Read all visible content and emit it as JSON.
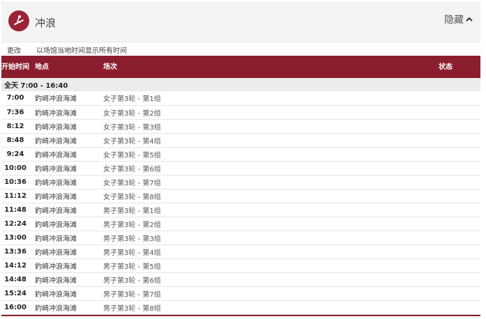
{
  "header": {
    "sport_title": "冲浪",
    "hide_label": "隐藏",
    "icon": "surfing-icon",
    "accent_color": "#8b1e2e"
  },
  "subbar": {
    "change_label": "更改",
    "timezone_note": "以场馆当地时间显示所有时间"
  },
  "table": {
    "headers": {
      "start_time": "开始时间",
      "venue": "地点",
      "event": "场次",
      "status": "状态"
    },
    "allday_label": "全天  7:00 - 16:40",
    "rows": [
      {
        "time": "7:00",
        "venue": "釣崎冲浪海滩",
        "event": "女子第3轮 - 第1组"
      },
      {
        "time": "7:36",
        "venue": "釣崎冲浪海滩",
        "event": "女子第3轮 - 第2组"
      },
      {
        "time": "8:12",
        "venue": "釣崎冲浪海滩",
        "event": "女子第3轮 - 第3组"
      },
      {
        "time": "8:48",
        "venue": "釣崎冲浪海滩",
        "event": "女子第3轮 - 第4组"
      },
      {
        "time": "9:24",
        "venue": "釣崎冲浪海滩",
        "event": "女子第3轮 - 第5组"
      },
      {
        "time": "10:00",
        "venue": "釣崎冲浪海滩",
        "event": "女子第3轮 - 第6组"
      },
      {
        "time": "10:36",
        "venue": "釣崎冲浪海滩",
        "event": "女子第3轮 - 第7组"
      },
      {
        "time": "11:12",
        "venue": "釣崎冲浪海滩",
        "event": "女子第3轮 - 第8组"
      },
      {
        "time": "11:48",
        "venue": "釣崎冲浪海滩",
        "event": "男子第3轮 - 第1组"
      },
      {
        "time": "12:24",
        "venue": "釣崎冲浪海滩",
        "event": "男子第3轮 - 第2组"
      },
      {
        "time": "13:00",
        "venue": "釣崎冲浪海滩",
        "event": "男子第3轮 - 第3组"
      },
      {
        "time": "13:36",
        "venue": "釣崎冲浪海滩",
        "event": "男子第3轮 - 第4组"
      },
      {
        "time": "14:12",
        "venue": "釣崎冲浪海滩",
        "event": "男子第3轮 - 第5组"
      },
      {
        "time": "14:48",
        "venue": "釣崎冲浪海滩",
        "event": "男子第3轮 - 第6组"
      },
      {
        "time": "15:24",
        "venue": "釣崎冲浪海滩",
        "event": "男子第3轮 - 第7组"
      },
      {
        "time": "16:00",
        "venue": "釣崎冲浪海滩",
        "event": "男子第3轮 - 第8组"
      }
    ]
  }
}
